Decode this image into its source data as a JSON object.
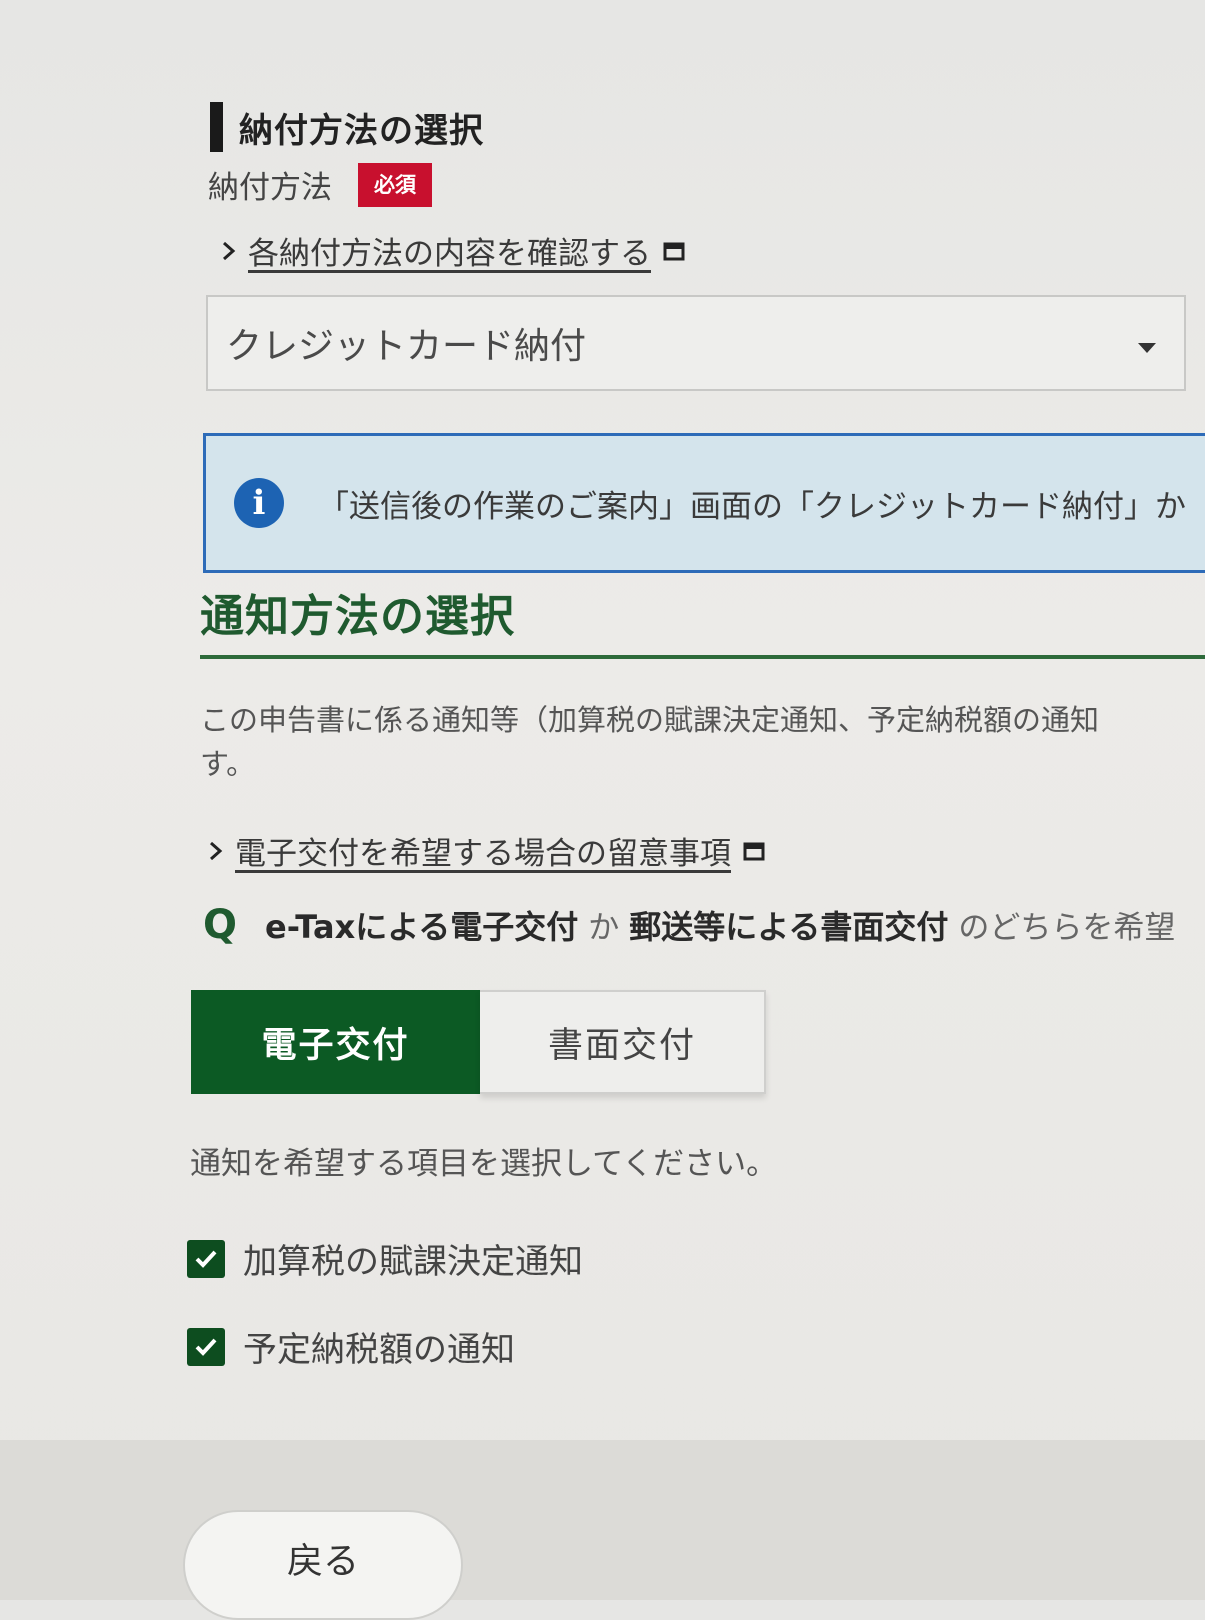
{
  "payment": {
    "heading": "納付方法の選択",
    "field_label": "納付方法",
    "required_badge": "必須",
    "details_link": "各納付方法の内容を確認する",
    "selected_method": "クレジットカード納付",
    "info_text": "「送信後の作業のご案内」画面の「クレジットカード納付」か"
  },
  "notification": {
    "heading": "通知方法の選択",
    "description_line1": "この申告書に係る通知等（加算税の賦課決定通知、予定納税額の通知",
    "description_line2": "す。",
    "notes_link": "電子交付を希望する場合の留意事項",
    "question_mark": "Q",
    "question_part1": "e-Taxによる電子交付",
    "question_part2": "か",
    "question_part3": "郵送等による書面交付",
    "question_part4": "のどちらを希望",
    "option_electronic": "電子交付",
    "option_paper": "書面交付",
    "instruction": "通知を希望する項目を選択してください。",
    "checkboxes": [
      {
        "label": "加算税の賦課決定通知",
        "checked": true
      },
      {
        "label": "予定納税額の通知",
        "checked": true
      }
    ]
  },
  "footer": {
    "back_label": "戻る"
  },
  "colors": {
    "primary_green": "#0c5a24",
    "heading_green": "#1f5a2f",
    "required_red": "#c8102e",
    "info_blue": "#1d63b3"
  }
}
